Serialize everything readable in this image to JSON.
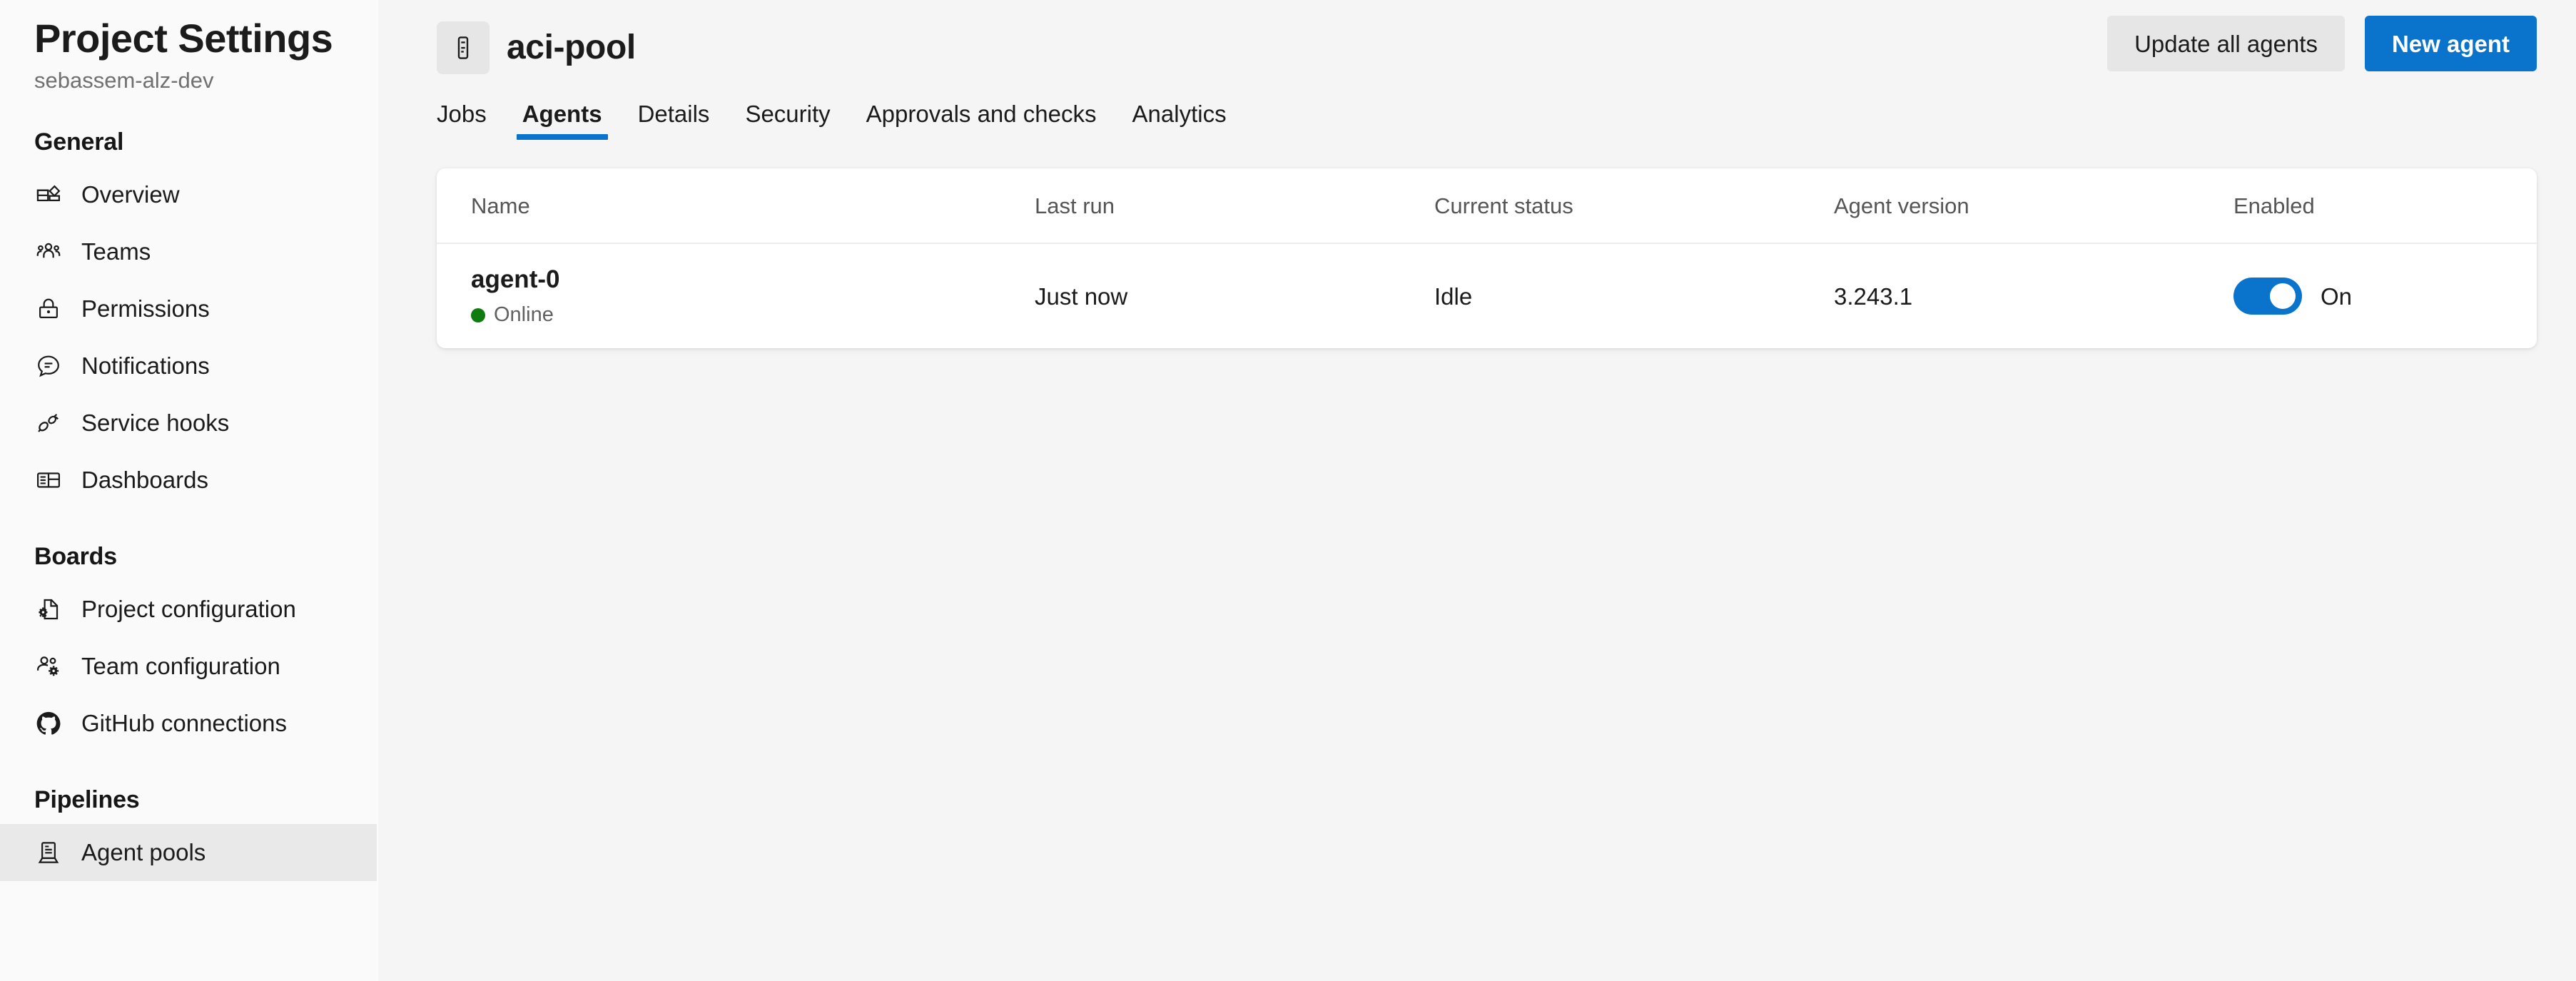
{
  "sidebar": {
    "title": "Project Settings",
    "project": "sebassem-alz-dev",
    "groups": [
      {
        "title": "General",
        "items": [
          {
            "label": "Overview",
            "icon": "overview-icon"
          },
          {
            "label": "Teams",
            "icon": "teams-icon"
          },
          {
            "label": "Permissions",
            "icon": "lock-icon"
          },
          {
            "label": "Notifications",
            "icon": "notification-icon"
          },
          {
            "label": "Service hooks",
            "icon": "plug-icon"
          },
          {
            "label": "Dashboards",
            "icon": "dashboard-icon"
          }
        ]
      },
      {
        "title": "Boards",
        "items": [
          {
            "label": "Project configuration",
            "icon": "file-gear-icon"
          },
          {
            "label": "Team configuration",
            "icon": "user-gear-icon"
          },
          {
            "label": "GitHub connections",
            "icon": "github-icon"
          }
        ]
      },
      {
        "title": "Pipelines",
        "items": [
          {
            "label": "Agent pools",
            "icon": "agent-pool-icon",
            "selected": true
          }
        ]
      }
    ]
  },
  "header": {
    "icon": "agent-pool-icon",
    "title": "aci-pool",
    "update_all_label": "Update all agents",
    "new_agent_label": "New agent"
  },
  "tabs": [
    {
      "label": "Jobs",
      "active": false
    },
    {
      "label": "Agents",
      "active": true
    },
    {
      "label": "Details",
      "active": false
    },
    {
      "label": "Security",
      "active": false
    },
    {
      "label": "Approvals and checks",
      "active": false
    },
    {
      "label": "Analytics",
      "active": false
    }
  ],
  "table": {
    "columns": [
      "Name",
      "Last run",
      "Current status",
      "Agent version",
      "Enabled"
    ],
    "rows": [
      {
        "name": "agent-0",
        "status_label": "Online",
        "status_color": "#107c10",
        "last_run": "Just now",
        "current_status": "Idle",
        "agent_version": "3.243.1",
        "enabled": true,
        "enabled_label": "On"
      }
    ]
  },
  "colors": {
    "accent": "#0a74cc",
    "online": "#107c10",
    "page_bg": "#f5f5f5",
    "sidebar_bg": "#fafafa",
    "selected_bg": "#e9e9e9"
  }
}
